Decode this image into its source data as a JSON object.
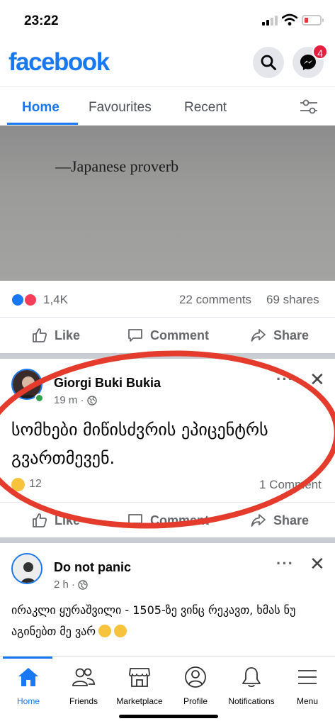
{
  "status": {
    "time": "23:22"
  },
  "header": {
    "logo": "facebook",
    "messenger_badge": "4"
  },
  "tabs": [
    {
      "label": "Home",
      "active": true
    },
    {
      "label": "Favourites",
      "active": false
    },
    {
      "label": "Recent",
      "active": false
    }
  ],
  "post1": {
    "photo_caption": "—Japanese proverb",
    "reaction_count": "1,4K",
    "comments": "22 comments",
    "shares": "69 shares",
    "actions": {
      "like": "Like",
      "comment": "Comment",
      "share": "Share"
    }
  },
  "post2": {
    "author": "Giorgi Buki Bukia",
    "time": "19 m ·",
    "text": "სომხები მიწისძვრის ეპიცენტრს გვართმევენ.",
    "reaction_count": "12",
    "comments": "1 Comment",
    "actions": {
      "like": "Like",
      "comment": "Comment",
      "share": "Share"
    }
  },
  "post3": {
    "author": "Do not panic",
    "time": "2 h ·",
    "text": "ირაკლი ყურაშვილი - 1505-ზე ვინც რეკავთ, ხმას ნუ აგინებთ მე ვარ"
  },
  "nav": [
    {
      "label": "Home",
      "icon": "home-icon",
      "active": true
    },
    {
      "label": "Friends",
      "icon": "friends-icon"
    },
    {
      "label": "Marketplace",
      "icon": "marketplace-icon"
    },
    {
      "label": "Profile",
      "icon": "profile-icon"
    },
    {
      "label": "Notifications",
      "icon": "bell-icon"
    },
    {
      "label": "Menu",
      "icon": "menu-icon"
    }
  ],
  "colors": {
    "brand": "#1877f2",
    "annotation": "#e43b2c",
    "badge": "#e41e3f"
  }
}
